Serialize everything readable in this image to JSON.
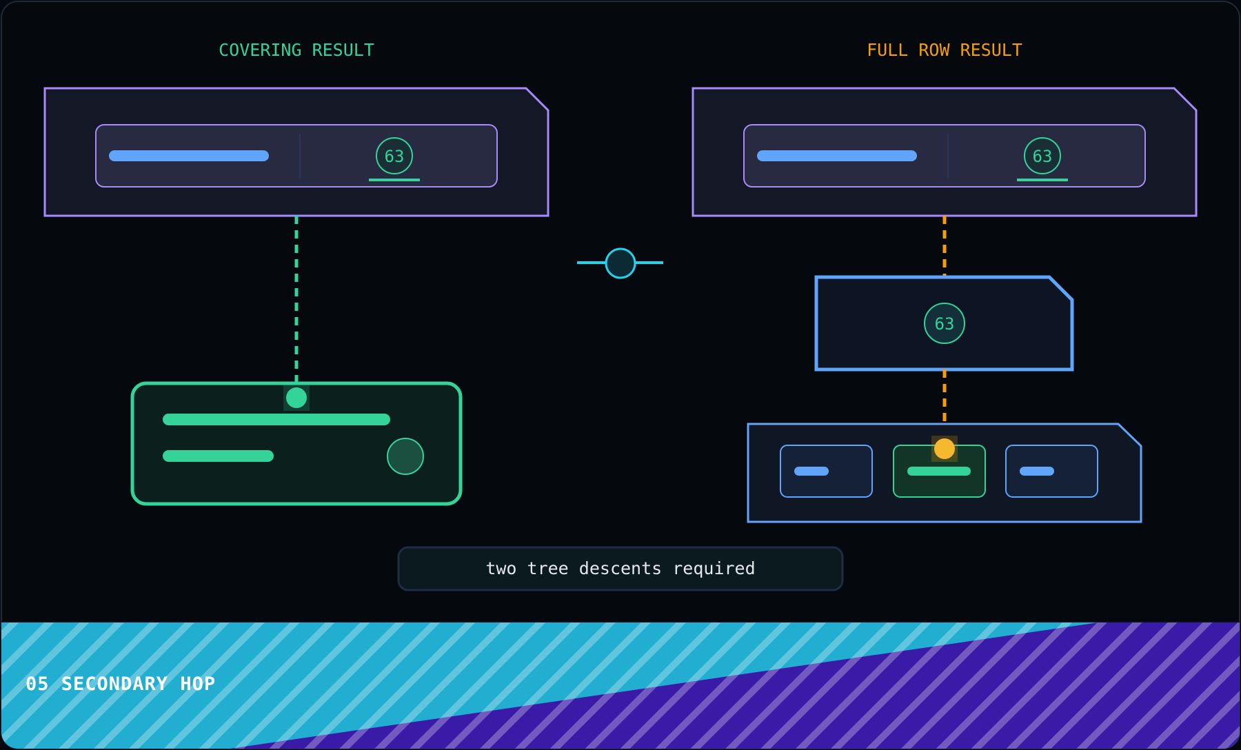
{
  "left_panel": {
    "title": "COVERING RESULT",
    "key_value": "63",
    "accent": "#34d399"
  },
  "right_panel": {
    "title": "FULL ROW RESULT",
    "key_value": "63",
    "lookup_value": "63",
    "accent": "#f59e0b"
  },
  "caption": "two tree descents required",
  "footer": {
    "label": "05 SECONDARY HOP"
  },
  "colors": {
    "background": "#05080d",
    "index_border": "#a78bfa",
    "leaf_border": "#34d399",
    "table_border": "#60a5fa",
    "bar_blue": "#60a5fa",
    "bar_green": "#34d399",
    "connector_cyan": "#22d3ee",
    "footer_cyan": "#22aed0",
    "footer_purple": "#3a1ba8"
  }
}
